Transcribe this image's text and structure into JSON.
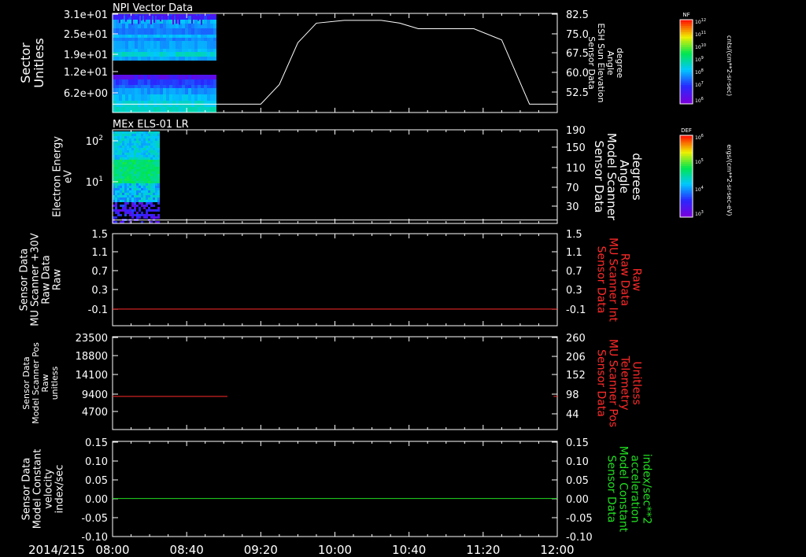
{
  "colors": {
    "background": "#000000",
    "axis": "#ffffff",
    "red": "#ff2a2a",
    "green": "#22dd22"
  },
  "footer": {
    "date_label": "2014/215"
  },
  "x_axis": {
    "tick_labels": [
      "08:00",
      "08:40",
      "09:20",
      "10:00",
      "10:40",
      "11:20",
      "12:00"
    ],
    "tick_values_min": [
      0,
      40,
      80,
      120,
      160,
      200,
      240
    ],
    "range_min": [
      0,
      240
    ]
  },
  "colorbars": [
    {
      "label": "NF",
      "unit": "cnts/(cm**2-sr-sec)",
      "tick_labels": [
        "10^12",
        "10^11",
        "10^10",
        "10^9",
        "10^8",
        "10^7",
        "10^6"
      ]
    },
    {
      "label": "DEF",
      "unit": "ergs/(cm**2-sr-sec-eV)",
      "tick_labels": [
        "10^6",
        "10^5",
        "10^4",
        "10^3"
      ]
    }
  ],
  "chart_data": [
    {
      "type": "heatmap",
      "title": "NPI Vector Data",
      "ylabel_left": [
        "Sector",
        "Unitless"
      ],
      "ylabel_right": [
        "Sensor Data",
        "ESH Sun Elevation",
        "Angle",
        "degree"
      ],
      "left_ticks": [
        "3.1e+01",
        "2.5e+01",
        "1.9e+01",
        "1.2e+01",
        "6.2e+00"
      ],
      "right_ticks": [
        "82.5",
        "75.0",
        "67.5",
        "60.0",
        "52.5"
      ],
      "right_range": [
        47,
        82.5
      ],
      "heatmap_x_range_min": [
        0,
        56
      ],
      "line_color": "white",
      "line_x_min": [
        0,
        80,
        90,
        100,
        110,
        125,
        145,
        155,
        165,
        185,
        195,
        210,
        225,
        240
      ],
      "line_y": [
        50,
        50,
        57,
        72,
        79,
        80,
        80,
        79,
        77,
        77,
        77,
        73,
        50,
        50
      ]
    },
    {
      "type": "heatmap",
      "title": "MEx ELS-01 LR",
      "ylabel_left": [
        "Electron Energy",
        "eV"
      ],
      "ylabel_right": [
        "Sensor Data",
        "Model Scanner",
        "Angle",
        "degrees"
      ],
      "left_ticks": [
        "10^2",
        "10^1"
      ],
      "right_ticks": [
        "190",
        "150",
        "110",
        "70",
        "30"
      ],
      "right_range": [
        0,
        190
      ],
      "heatmap_x_range_min": [
        0,
        25
      ],
      "line_color": "white",
      "line_x_min": [
        0,
        240
      ],
      "line_y": [
        7,
        7
      ]
    },
    {
      "type": "line",
      "ylabel_left": [
        "Sensor Data",
        "MU Scanner +30V",
        "Raw Data",
        "Raw"
      ],
      "ylabel_right": [
        "Sensor Data",
        "MU Scanner Int",
        "Raw Data",
        "Raw"
      ],
      "left_ticks": [
        "1.5",
        "1.1",
        "0.7",
        "0.3",
        "-0.1"
      ],
      "right_ticks": [
        "1.5",
        "1.1",
        "0.7",
        "0.3",
        "-0.1"
      ],
      "y_range": [
        -0.33,
        1.5
      ],
      "line_color": "red",
      "line_x_min": [
        0,
        240
      ],
      "line_y": [
        0.0,
        0.0
      ]
    },
    {
      "type": "line",
      "ylabel_left": [
        "Sensor Data",
        "Model Scanner Pos",
        "Raw",
        "unitless"
      ],
      "ylabel_right": [
        "Sensor Data",
        "MU Scanner Pos",
        "Telemetry",
        "Unitless"
      ],
      "left_ticks": [
        "23500",
        "18800",
        "14100",
        "9400",
        "4700"
      ],
      "right_ticks": [
        "260",
        "206",
        "152",
        "98",
        "44"
      ],
      "y_range": [
        0,
        23500
      ],
      "line_color": "red",
      "line_x_min": [
        0,
        62
      ],
      "line_y": [
        8400,
        8400
      ],
      "line2_x_min": [
        238,
        240
      ],
      "line2_y": [
        8400,
        8400
      ]
    },
    {
      "type": "line",
      "ylabel_left": [
        "Sensor Data",
        "Model Constant",
        "velocity",
        "index/sec"
      ],
      "ylabel_right": [
        "Sensor Data",
        "Model Constant",
        "acceleration",
        "index/sec**2"
      ],
      "left_ticks": [
        "0.15",
        "0.10",
        "0.05",
        "0.00",
        "-0.05",
        "-0.10"
      ],
      "right_ticks": [
        "0.15",
        "0.10",
        "0.05",
        "0.00",
        "-0.05",
        "-0.10"
      ],
      "y_range": [
        -0.1,
        0.15
      ],
      "line_color": "green",
      "line_x_min": [
        0,
        240
      ],
      "line_y": [
        0.0,
        0.0
      ]
    }
  ]
}
